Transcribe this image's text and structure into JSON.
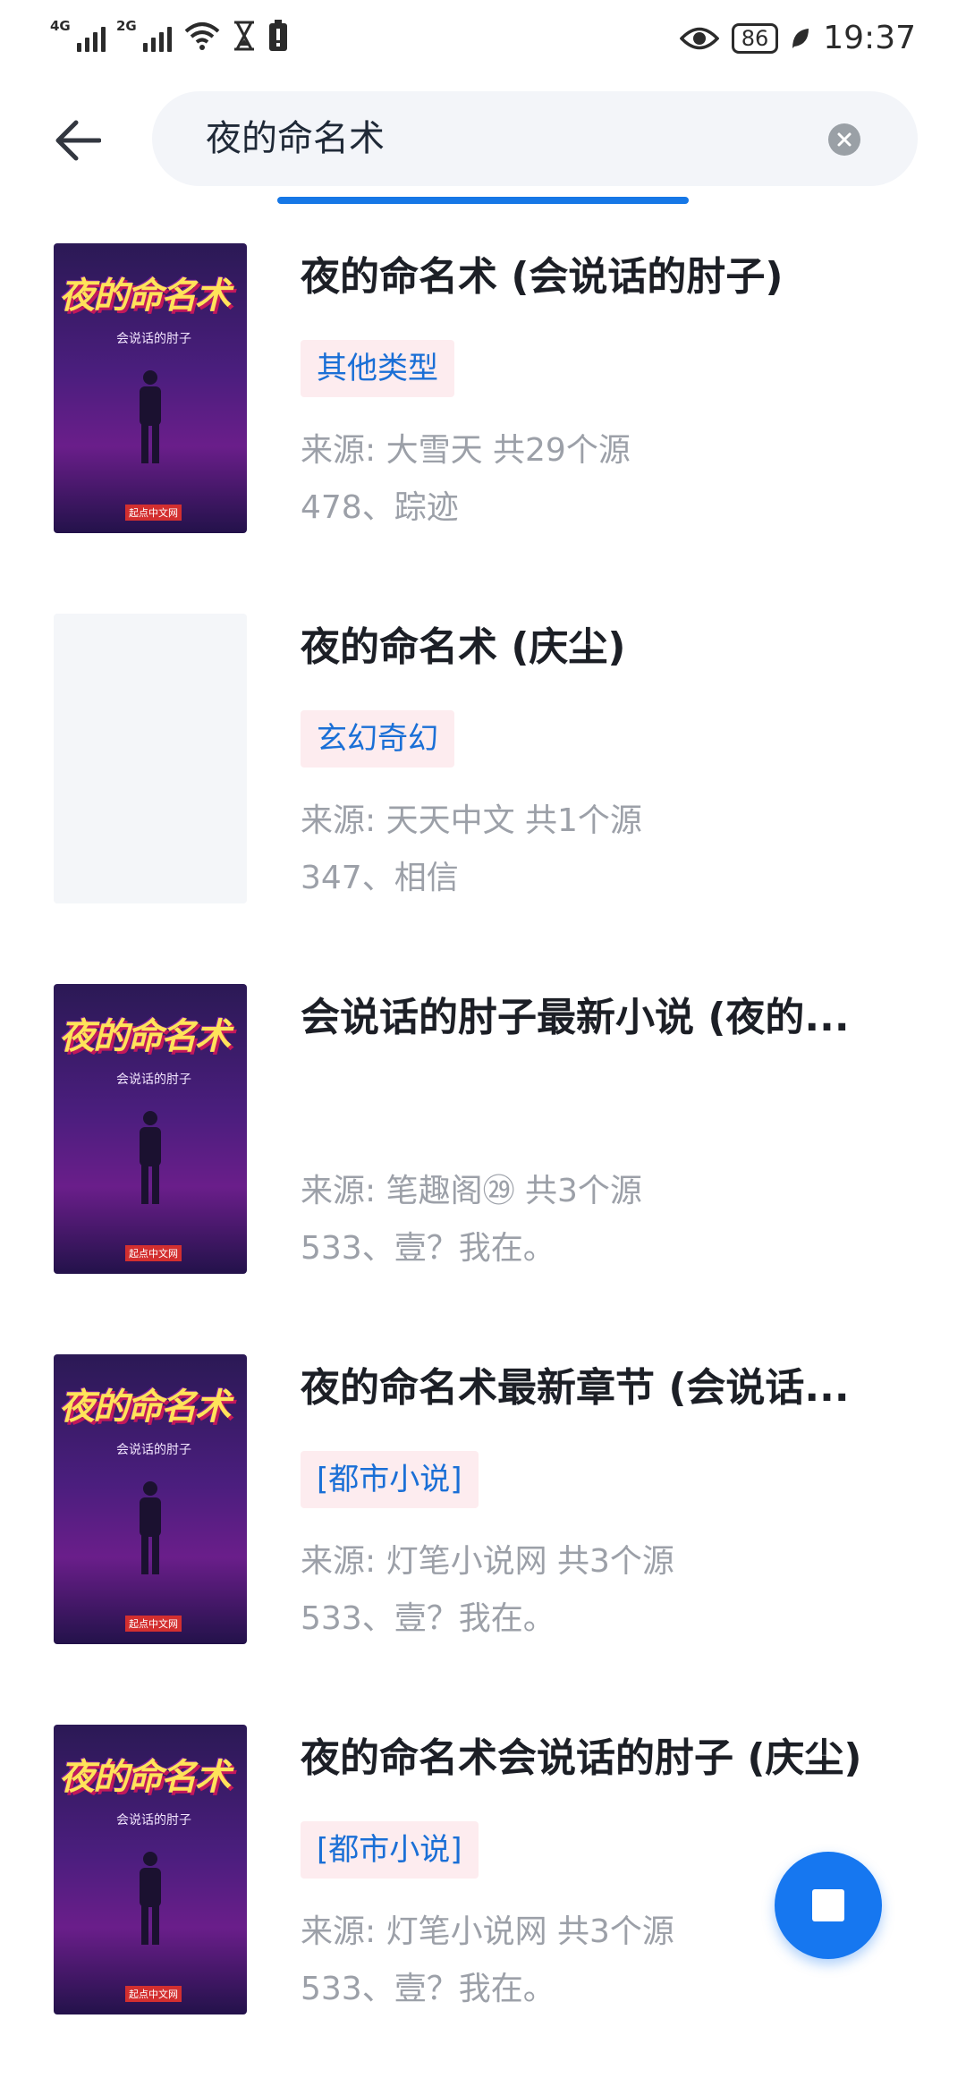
{
  "status_bar": {
    "net1": "4G",
    "net2": "2G",
    "battery": "86",
    "time": "19:37"
  },
  "search": {
    "query": "夜的命名术"
  },
  "results": [
    {
      "title": "夜的命名术 (会说话的肘子)",
      "tag": "其他类型",
      "source": "来源: 大雪天  共29个源",
      "latest": "478、踪迹",
      "has_cover": true
    },
    {
      "title": "夜的命名术 (庆尘)",
      "tag": "玄幻奇幻",
      "source": "来源: 天天中文  共1个源",
      "latest": "347、相信",
      "has_cover": false
    },
    {
      "title": "会说话的肘子最新小说 (夜的...",
      "tag": "",
      "source": "来源: 笔趣阁㉙  共3个源",
      "latest": "533、壹？我在。",
      "has_cover": true
    },
    {
      "title": "夜的命名术最新章节 (会说话...",
      "tag": "[都市小说]",
      "source": "来源: 灯笔小说网  共3个源",
      "latest": "533、壹？我在。",
      "has_cover": true
    },
    {
      "title": "夜的命名术会说话的肘子 (庆尘)",
      "tag": "[都市小说]",
      "source": "来源: 灯笔小说网  共3个源",
      "latest": "533、壹？我在。",
      "has_cover": true
    }
  ],
  "cover_art": {
    "title": "夜的命名术",
    "author": "会说话的肘子",
    "publisher": "起点中文网"
  },
  "colors": {
    "accent": "#1677f0",
    "tag_bg": "#fdecef",
    "tag_text": "#1a6fd6",
    "secondary_text": "#9ca0a8"
  },
  "icons": {
    "back": "arrow-left-icon",
    "clear": "clear-circle-icon",
    "fab": "stop-icon"
  }
}
